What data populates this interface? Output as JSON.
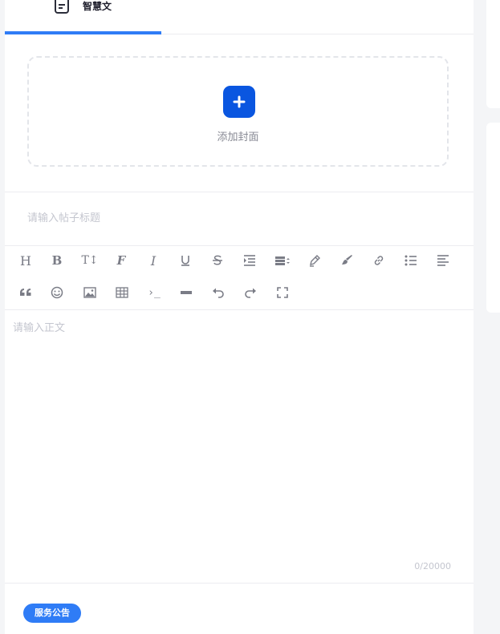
{
  "tabs": [
    {
      "label": "智慧文",
      "icon": "document-icon",
      "active": true
    }
  ],
  "cover": {
    "label": "添加封面",
    "icon": "plus-icon"
  },
  "title_input": {
    "value": "",
    "placeholder": "请输入帖子标题"
  },
  "toolbar": {
    "row1": [
      "heading-icon",
      "bold-icon",
      "font-size-icon",
      "font-family-icon",
      "italic-icon",
      "underline-icon",
      "strikethrough-icon",
      "indent-icon",
      "line-height-icon",
      "font-color-icon",
      "background-color-icon",
      "link-icon",
      "bullet-list-icon",
      "align-left-icon"
    ],
    "row2": [
      "quote-icon",
      "emoji-icon",
      "image-icon",
      "table-icon",
      "code-icon",
      "divider-icon",
      "undo-icon",
      "redo-icon",
      "fullscreen-icon"
    ],
    "glyphs": {
      "heading": "H",
      "bold": "B",
      "font_size": "T↕",
      "font_family": "F",
      "italic": "I",
      "code": "›_"
    }
  },
  "editor": {
    "value": "",
    "placeholder": "请输入正文"
  },
  "counter": "0/20000",
  "tag": {
    "label": "服务公告"
  },
  "colors": {
    "accent": "#2f7cf6",
    "cover_button": "#0a56e0"
  }
}
